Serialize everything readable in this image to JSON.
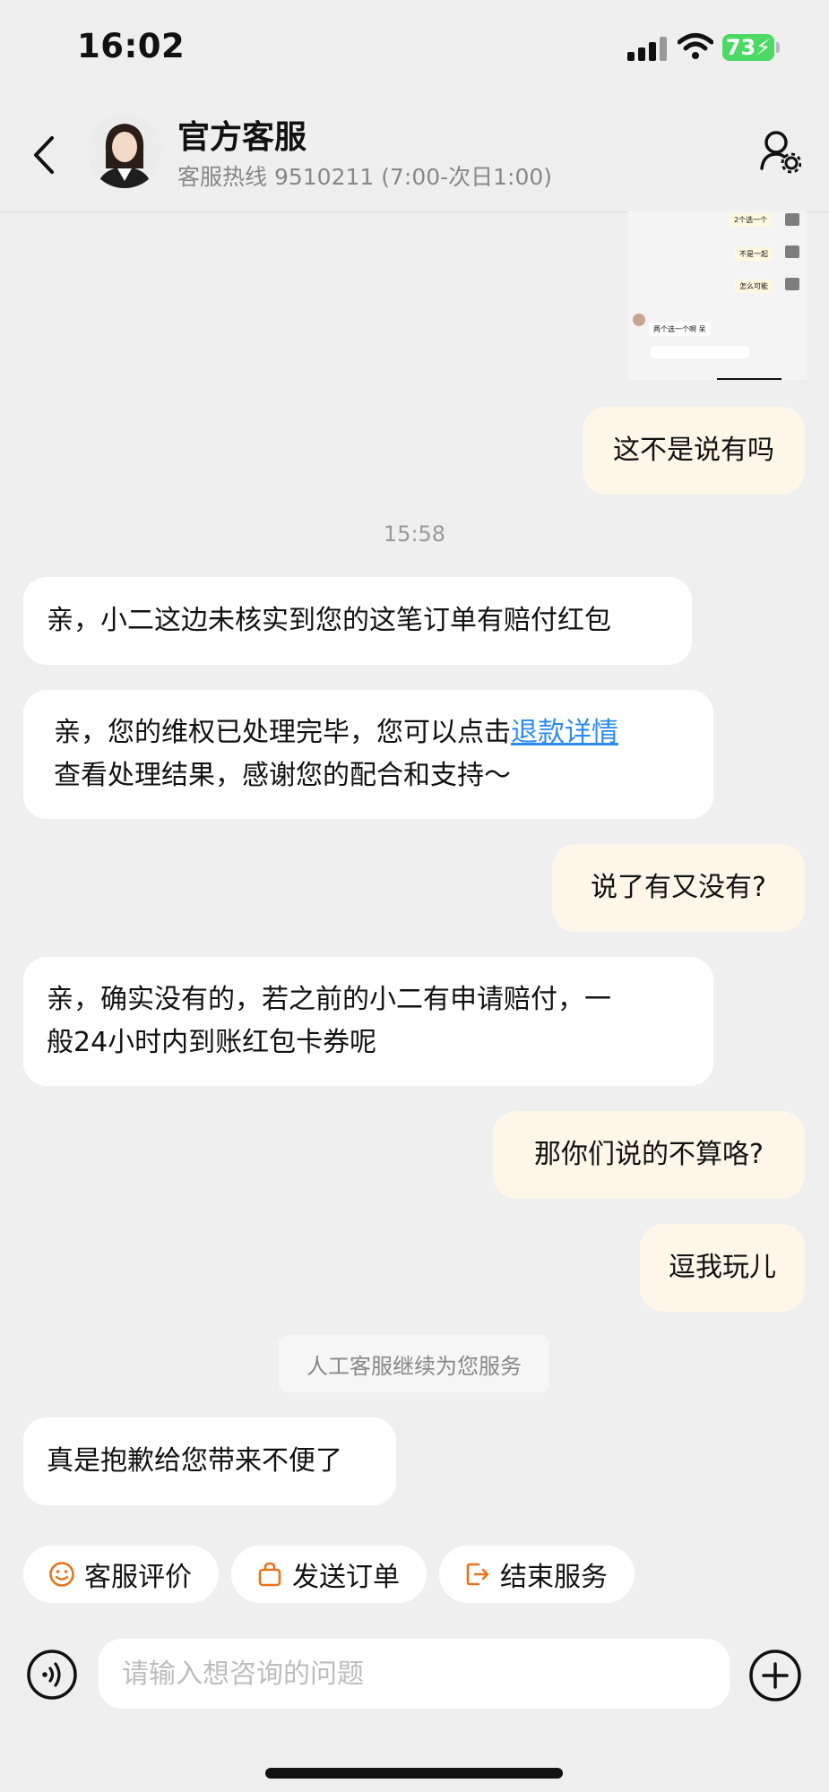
{
  "status_bar": {
    "time": "16:02",
    "battery": "73"
  },
  "header": {
    "title": "官方客服",
    "subtitle": "客服热线 9510211 (7:00-次日1:00)"
  },
  "thumbnail": {
    "bubbles": [
      "2个选一个",
      "不是一起",
      "怎么可能"
    ],
    "received": "两个选一个啊 呆"
  },
  "messages": {
    "m1": "这不是说有吗",
    "time": "15:58",
    "m2": "亲，小二这边未核实到您的这笔订单有赔付红包",
    "m3_part1": "亲，您的维权已处理完毕，您可以点击",
    "m3_link": "退款详情",
    "m3_part2": "查看处理结果，感谢您的配合和支持～",
    "m4": "说了有又没有?",
    "m5_line1": "亲，确实没有的，若之前的小二有申请赔付，一",
    "m5_line2": "般24小时内到账红包卡券呢",
    "m6": "那你们说的不算咯?",
    "m7": "逗我玩儿",
    "system_note": "人工客服继续为您服务",
    "m8": "真是抱歉给您带来不便了"
  },
  "quick_actions": {
    "rate": "客服评价",
    "send_order": "发送订单",
    "end_service": "结束服务"
  },
  "input": {
    "placeholder": "请输入想咨询的问题"
  },
  "colors": {
    "accent": "#e8731c",
    "link": "#2d8cf0",
    "outgoing_bubble": "#fdf6e9",
    "background": "#efefef"
  }
}
